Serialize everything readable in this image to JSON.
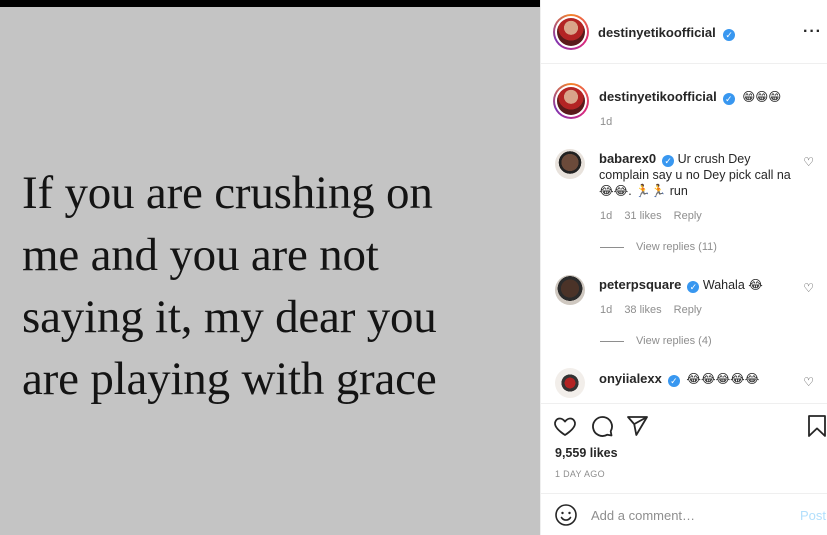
{
  "post": {
    "image_text": "If you are crushing on\nme and you are not\nsaying it, my dear you\nare playing with grace"
  },
  "header": {
    "username": "destinyetikoofficial",
    "verified_icon": "verified-badge-icon",
    "more_icon": "more-options-icon"
  },
  "caption": {
    "username": "destinyetikoofficial",
    "text": "😁😁😁",
    "time": "1d"
  },
  "comments": [
    {
      "username": "babarex0",
      "text": "Ur crush Dey complain say u no Dey pick call na 😂😂. 🏃🏃 run",
      "time": "1d",
      "likes": "31 likes",
      "reply_label": "Reply",
      "view_replies": "View replies (11)"
    },
    {
      "username": "peterpsquare",
      "text": "Wahala 😂",
      "time": "1d",
      "likes": "38 likes",
      "reply_label": "Reply",
      "view_replies": "View replies (4)"
    },
    {
      "username": "onyiialexx",
      "text": "😂😂😂😂😂"
    }
  ],
  "actions": {
    "likes": "9,559 likes",
    "time_ago": "1 DAY AGO"
  },
  "comment_box": {
    "placeholder": "Add a comment…",
    "post_label": "Post"
  },
  "colors": {
    "verified": "#3897f0",
    "post_button": "#b2dffc",
    "muted_text": "#8e8e8e",
    "image_background": "#c4c4c4"
  }
}
